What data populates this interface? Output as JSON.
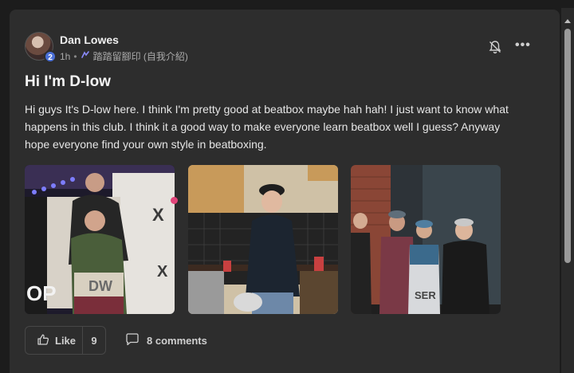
{
  "post": {
    "author": "Dan Lowes",
    "level": "2",
    "time": "1h",
    "separator": "•",
    "channel": "踏踏留腳印 (自我介紹)",
    "title": "Hi I'm D-low",
    "body": "Hi guys It's D-low here. I think I'm pretty good at beatbox maybe hah hah! I just want to know what happens in this club. I think it a good way to make everyone learn beatbox well I guess? Anyway hope everyone find your own style in beatboxing.",
    "more_label": "•••"
  },
  "photos": [
    {
      "alt": "two young men posing in front of a graffiti banner with purple stage lights"
    },
    {
      "alt": "young man in a dark jacket and cap standing in a kitchen"
    },
    {
      "alt": "group of five young men posing against a brick wall and dark door"
    }
  ],
  "actions": {
    "like_label": "Like",
    "like_count": "9",
    "comments_label": "8 comments"
  },
  "colors": {
    "card": "#2d2d2d",
    "accent_badge": "#4a6fd6",
    "pink_dot": "#e2457a"
  }
}
